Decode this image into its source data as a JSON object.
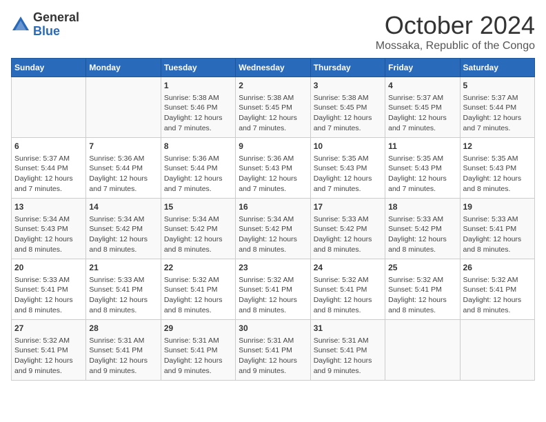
{
  "logo": {
    "general": "General",
    "blue": "Blue"
  },
  "header": {
    "month": "October 2024",
    "location": "Mossaka, Republic of the Congo"
  },
  "days_of_week": [
    "Sunday",
    "Monday",
    "Tuesday",
    "Wednesday",
    "Thursday",
    "Friday",
    "Saturday"
  ],
  "weeks": [
    [
      {
        "day": "",
        "content": ""
      },
      {
        "day": "",
        "content": ""
      },
      {
        "day": "1",
        "content": "Sunrise: 5:38 AM\nSunset: 5:46 PM\nDaylight: 12 hours\nand 7 minutes."
      },
      {
        "day": "2",
        "content": "Sunrise: 5:38 AM\nSunset: 5:45 PM\nDaylight: 12 hours\nand 7 minutes."
      },
      {
        "day": "3",
        "content": "Sunrise: 5:38 AM\nSunset: 5:45 PM\nDaylight: 12 hours\nand 7 minutes."
      },
      {
        "day": "4",
        "content": "Sunrise: 5:37 AM\nSunset: 5:45 PM\nDaylight: 12 hours\nand 7 minutes."
      },
      {
        "day": "5",
        "content": "Sunrise: 5:37 AM\nSunset: 5:44 PM\nDaylight: 12 hours\nand 7 minutes."
      }
    ],
    [
      {
        "day": "6",
        "content": "Sunrise: 5:37 AM\nSunset: 5:44 PM\nDaylight: 12 hours\nand 7 minutes."
      },
      {
        "day": "7",
        "content": "Sunrise: 5:36 AM\nSunset: 5:44 PM\nDaylight: 12 hours\nand 7 minutes."
      },
      {
        "day": "8",
        "content": "Sunrise: 5:36 AM\nSunset: 5:44 PM\nDaylight: 12 hours\nand 7 minutes."
      },
      {
        "day": "9",
        "content": "Sunrise: 5:36 AM\nSunset: 5:43 PM\nDaylight: 12 hours\nand 7 minutes."
      },
      {
        "day": "10",
        "content": "Sunrise: 5:35 AM\nSunset: 5:43 PM\nDaylight: 12 hours\nand 7 minutes."
      },
      {
        "day": "11",
        "content": "Sunrise: 5:35 AM\nSunset: 5:43 PM\nDaylight: 12 hours\nand 7 minutes."
      },
      {
        "day": "12",
        "content": "Sunrise: 5:35 AM\nSunset: 5:43 PM\nDaylight: 12 hours\nand 8 minutes."
      }
    ],
    [
      {
        "day": "13",
        "content": "Sunrise: 5:34 AM\nSunset: 5:43 PM\nDaylight: 12 hours\nand 8 minutes."
      },
      {
        "day": "14",
        "content": "Sunrise: 5:34 AM\nSunset: 5:42 PM\nDaylight: 12 hours\nand 8 minutes."
      },
      {
        "day": "15",
        "content": "Sunrise: 5:34 AM\nSunset: 5:42 PM\nDaylight: 12 hours\nand 8 minutes."
      },
      {
        "day": "16",
        "content": "Sunrise: 5:34 AM\nSunset: 5:42 PM\nDaylight: 12 hours\nand 8 minutes."
      },
      {
        "day": "17",
        "content": "Sunrise: 5:33 AM\nSunset: 5:42 PM\nDaylight: 12 hours\nand 8 minutes."
      },
      {
        "day": "18",
        "content": "Sunrise: 5:33 AM\nSunset: 5:42 PM\nDaylight: 12 hours\nand 8 minutes."
      },
      {
        "day": "19",
        "content": "Sunrise: 5:33 AM\nSunset: 5:41 PM\nDaylight: 12 hours\nand 8 minutes."
      }
    ],
    [
      {
        "day": "20",
        "content": "Sunrise: 5:33 AM\nSunset: 5:41 PM\nDaylight: 12 hours\nand 8 minutes."
      },
      {
        "day": "21",
        "content": "Sunrise: 5:33 AM\nSunset: 5:41 PM\nDaylight: 12 hours\nand 8 minutes."
      },
      {
        "day": "22",
        "content": "Sunrise: 5:32 AM\nSunset: 5:41 PM\nDaylight: 12 hours\nand 8 minutes."
      },
      {
        "day": "23",
        "content": "Sunrise: 5:32 AM\nSunset: 5:41 PM\nDaylight: 12 hours\nand 8 minutes."
      },
      {
        "day": "24",
        "content": "Sunrise: 5:32 AM\nSunset: 5:41 PM\nDaylight: 12 hours\nand 8 minutes."
      },
      {
        "day": "25",
        "content": "Sunrise: 5:32 AM\nSunset: 5:41 PM\nDaylight: 12 hours\nand 8 minutes."
      },
      {
        "day": "26",
        "content": "Sunrise: 5:32 AM\nSunset: 5:41 PM\nDaylight: 12 hours\nand 8 minutes."
      }
    ],
    [
      {
        "day": "27",
        "content": "Sunrise: 5:32 AM\nSunset: 5:41 PM\nDaylight: 12 hours\nand 9 minutes."
      },
      {
        "day": "28",
        "content": "Sunrise: 5:31 AM\nSunset: 5:41 PM\nDaylight: 12 hours\nand 9 minutes."
      },
      {
        "day": "29",
        "content": "Sunrise: 5:31 AM\nSunset: 5:41 PM\nDaylight: 12 hours\nand 9 minutes."
      },
      {
        "day": "30",
        "content": "Sunrise: 5:31 AM\nSunset: 5:41 PM\nDaylight: 12 hours\nand 9 minutes."
      },
      {
        "day": "31",
        "content": "Sunrise: 5:31 AM\nSunset: 5:41 PM\nDaylight: 12 hours\nand 9 minutes."
      },
      {
        "day": "",
        "content": ""
      },
      {
        "day": "",
        "content": ""
      }
    ]
  ]
}
